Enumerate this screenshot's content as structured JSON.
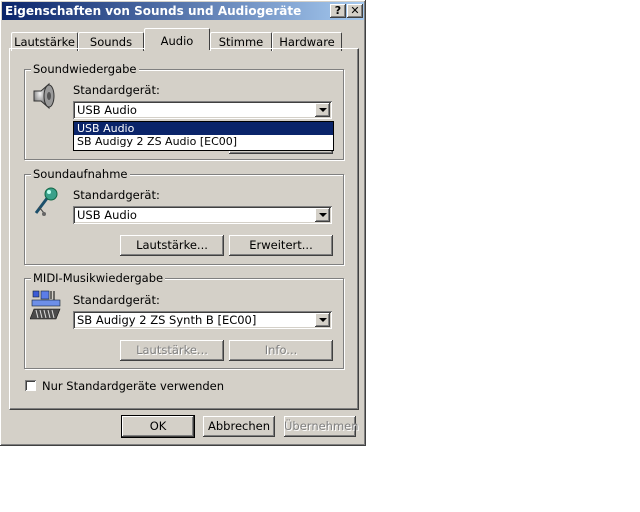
{
  "window": {
    "title": "Eigenschaften von Sounds und Audiogeräte",
    "help_btn": "?",
    "close_btn": "✕"
  },
  "tabs": [
    {
      "label": "Lautstärke"
    },
    {
      "label": "Sounds"
    },
    {
      "label": "Audio"
    },
    {
      "label": "Stimme"
    },
    {
      "label": "Hardware"
    }
  ],
  "active_tab": "Audio",
  "playback": {
    "group_label": "Soundwiedergabe",
    "device_label": "Standardgerät:",
    "selected": "USB Audio",
    "options": [
      "USB Audio",
      "SB Audigy 2 ZS Audio [EC00]"
    ]
  },
  "recording": {
    "group_label": "Soundaufnahme",
    "device_label": "Standardgerät:",
    "selected": "USB Audio",
    "volume_btn": "Lautstärke...",
    "advanced_btn": "Erweitert..."
  },
  "midi": {
    "group_label": "MIDI-Musikwiedergabe",
    "device_label": "Standardgerät:",
    "selected": "SB Audigy 2 ZS Synth B [EC00]",
    "volume_btn": "Lautstärke...",
    "info_btn": "Info..."
  },
  "only_default_checkbox": {
    "label": "Nur Standardgeräte verwenden",
    "checked": false
  },
  "footer": {
    "ok": "OK",
    "cancel": "Abbrechen",
    "apply": "Übernehmen"
  }
}
